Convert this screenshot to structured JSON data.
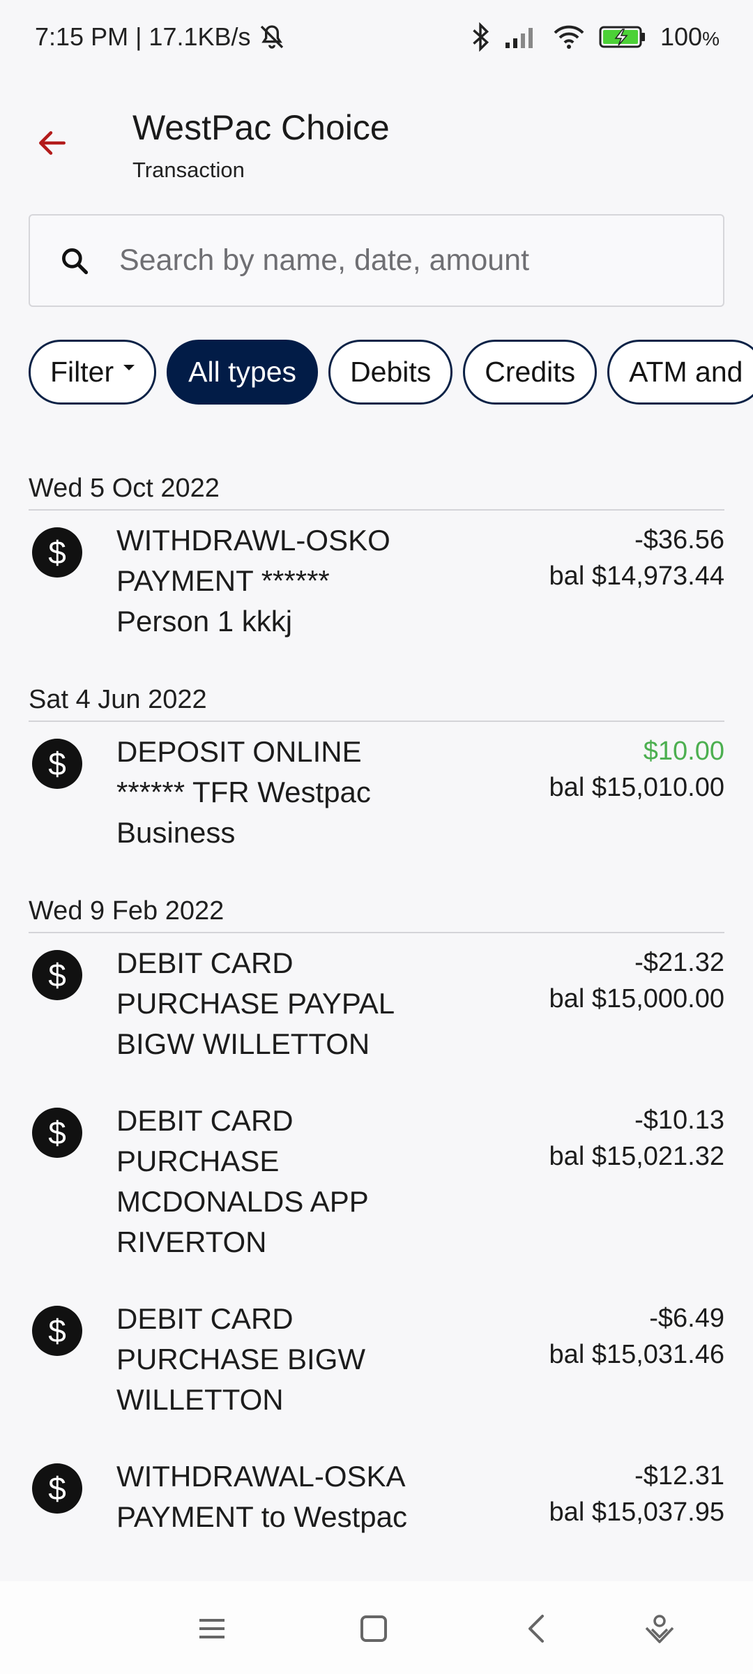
{
  "status_bar": {
    "time_speed": "7:15 PM | 17.1KB/s",
    "battery": "100",
    "battery_unit": "%",
    "icons": [
      "mute-bell-icon",
      "bluetooth-icon",
      "signal-icon",
      "wifi-icon",
      "battery-charging-icon"
    ]
  },
  "header": {
    "title": "WestPac Choice",
    "subtitle": "Transaction",
    "back_icon": "arrow-left-icon"
  },
  "search": {
    "placeholder": "Search by name, date, amount",
    "value": ""
  },
  "filters": {
    "chips": [
      {
        "label": "Filter",
        "active": false
      },
      {
        "label": "All types",
        "active": true
      },
      {
        "label": "Debits",
        "active": false
      },
      {
        "label": "Credits",
        "active": false
      },
      {
        "label": "ATM and",
        "active": false
      }
    ]
  },
  "groups": [
    {
      "date": "Wed 5 Oct 2022",
      "transactions": [
        {
          "lines": [
            "WITHDRAWL-OSKO",
            "PAYMENT ******",
            "Person 1 kkkj"
          ],
          "amount": "-$36.56",
          "balance": "bal $14,973.44",
          "type": "debit"
        }
      ]
    },
    {
      "date": "Sat 4 Jun 2022",
      "transactions": [
        {
          "lines": [
            "DEPOSIT ONLINE",
            "****** TFR Westpac",
            "Business"
          ],
          "amount": "$10.00",
          "balance": "bal $15,010.00",
          "type": "credit"
        }
      ]
    },
    {
      "date": "Wed 9 Feb 2022",
      "transactions": [
        {
          "lines": [
            "DEBIT CARD",
            "PURCHASE PAYPAL",
            "BIGW WILLETTON"
          ],
          "amount": "-$21.32",
          "balance": "bal $15,000.00",
          "type": "debit"
        },
        {
          "lines": [
            "DEBIT CARD",
            "PURCHASE",
            "MCDONALDS APP",
            "RIVERTON"
          ],
          "amount": "-$10.13",
          "balance": "bal $15,021.32",
          "type": "debit"
        },
        {
          "lines": [
            "DEBIT CARD",
            "PURCHASE BIGW",
            "WILLETTON"
          ],
          "amount": "-$6.49",
          "balance": "bal $15,031.46",
          "type": "debit"
        },
        {
          "lines": [
            "WITHDRAWAL-OSKA",
            "PAYMENT to Westpac"
          ],
          "amount": "-$12.31",
          "balance": "bal $15,037.95",
          "type": "debit"
        }
      ]
    }
  ],
  "nav": {
    "icons": [
      "menu-icon",
      "home-square-icon",
      "back-chevron-icon",
      "assistant-icon"
    ]
  },
  "colors": {
    "accent_red": "#b31b1b",
    "chip_active_bg": "#021c47",
    "credit_green": "#4caf50",
    "background": "#f7f7f9"
  }
}
